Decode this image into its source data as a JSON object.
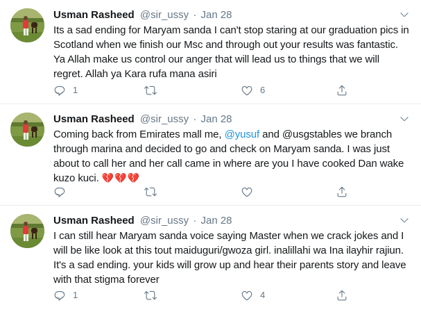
{
  "colors": {
    "link": "#1b95e0",
    "secondary": "#657786",
    "text": "#14171a",
    "divider": "#e6ecf0",
    "heart": "#d2344f"
  },
  "icons": {
    "reply": "reply-icon",
    "retweet": "retweet-icon",
    "like": "like-icon",
    "share": "share-icon",
    "more": "chevron-down-icon"
  },
  "tweets": [
    {
      "author_name": "Usman Rasheed",
      "handle": "@sir_ussy",
      "separator": "·",
      "date": "Jan 28",
      "text_before": "Its a sad ending for Maryam sanda I can't stop staring at our graduation pics in Scotland when we finish our Msc and through out your results was fantastic. Ya Allah make us control our anger that will lead us to things that we will regret. Allah ya Kara rufa mana asiri",
      "mention": "",
      "text_after": "",
      "emoji": "",
      "replies": "1",
      "retweets": "",
      "likes": "6"
    },
    {
      "author_name": "Usman Rasheed",
      "handle": "@sir_ussy",
      "separator": "·",
      "date": "Jan 28",
      "text_before": "Coming back from Emirates mall me, ",
      "mention": "@yusuf",
      "text_after": " and @usgstables we branch through marina and decided to go and check on Maryam sanda. I was just about to call her and her call came in where are you I have cooked Dan wake kuzo kuci. ",
      "emoji": "💔💔💔",
      "replies": "",
      "retweets": "",
      "likes": ""
    },
    {
      "author_name": "Usman Rasheed",
      "handle": "@sir_ussy",
      "separator": "·",
      "date": "Jan 28",
      "text_before": "I can still hear Maryam sanda voice saying Master when we crack jokes and I will be like look at this tout maiduguri/gwoza girl. inalillahi wa Ina ilayhir rajiun. It's a sad ending. your kids will grow up and hear their parents story and leave with that stigma forever",
      "mention": "",
      "text_after": "",
      "emoji": "",
      "replies": "1",
      "retweets": "",
      "likes": "4"
    }
  ]
}
